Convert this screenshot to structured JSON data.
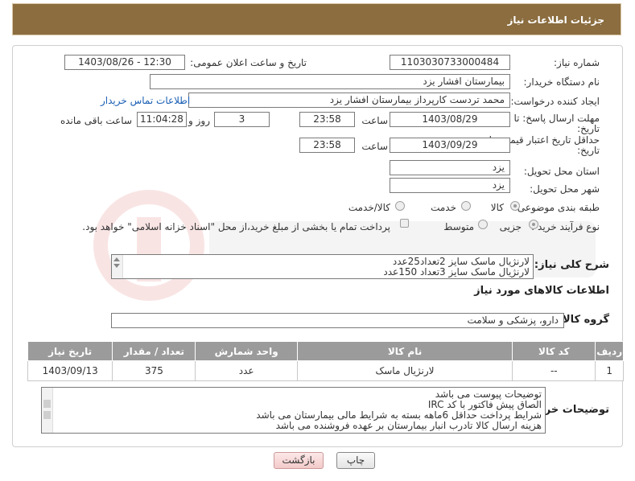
{
  "header": {
    "title": "جزئیات اطلاعات نیاز"
  },
  "form": {
    "need_number_label": "شماره نیاز:",
    "need_number": "1103030733000484",
    "announce_label": "تاریخ و ساعت اعلان عمومی:",
    "announce_value": "1403/08/26 - 12:30",
    "buyer_org_label": "نام دستگاه خریدار:",
    "buyer_org": "بیمارستان افشار یزد",
    "requester_label": "ایجاد کننده درخواست:",
    "requester": "محمد تردست کارپرداز بیمارستان افشار یزد",
    "contact_link": "اطلاعات تماس خریدار",
    "deadline_label_1": "مهلت ارسال پاسخ: تا",
    "deadline_label_2": "تاریخ:",
    "deadline_date": "1403/08/29",
    "time_label": "ساعت",
    "deadline_time": "23:58",
    "days_value": "3",
    "days_label": "روز و",
    "remaining_time": "11:04:28",
    "remaining_label": "ساعت باقی مانده",
    "validity_label_1": "حداقل تاریخ اعتبار قیمت: تا",
    "validity_label_2": "تاریخ:",
    "validity_date": "1403/09/29",
    "validity_time": "23:58",
    "province_label": "استان محل تحویل:",
    "province": "یزد",
    "city_label": "شهر محل تحویل:",
    "city": "یزد",
    "category_label": "طبقه بندی موضوعی:",
    "category_options": [
      "کالا",
      "خدمت",
      "کالا/خدمت"
    ],
    "process_label": "نوع فرآیند خرید :",
    "process_options": [
      "جزیی",
      "متوسط"
    ],
    "payment_note": "پرداخت تمام یا بخشی از مبلغ خرید،از محل \"اسناد خزانه اسلامی\" خواهد بود."
  },
  "description": {
    "label": "شرح کلی نیاز:",
    "lines": [
      "لارنژیال ماسک سایز 2تعداد25عدد",
      "لارنژیال ماسک سایز 3تعداد 150عدد"
    ]
  },
  "goods": {
    "section_title": "اطلاعات کالاهای مورد نیاز",
    "group_label": "گروه کالا:",
    "group_value": "دارو، پزشکی و سلامت",
    "columns": [
      "ردیف",
      "کد کالا",
      "نام کالا",
      "واحد شمارش",
      "تعداد / مقدار",
      "تاریخ نیاز"
    ],
    "rows": [
      {
        "row": "1",
        "code": "--",
        "name": "لارنژیال ماسک",
        "unit": "عدد",
        "qty": "375",
        "date": "1403/09/13"
      }
    ]
  },
  "buyer_notes": {
    "label": "توضیحات خریدار:",
    "lines": [
      "توضیحات پیوست می باشد",
      "الصاق پیش فاکتور با کد  IRC",
      "شرایط پرداخت   حداقل 6ماهه بسته به شرایط مالی بیمارستان می باشد",
      "هزینه ارسال کالا تادرب انبار بیمارستان بر عهده فروشنده می باشد"
    ]
  },
  "buttons": {
    "print": "چاپ",
    "back": "بازگشت"
  }
}
